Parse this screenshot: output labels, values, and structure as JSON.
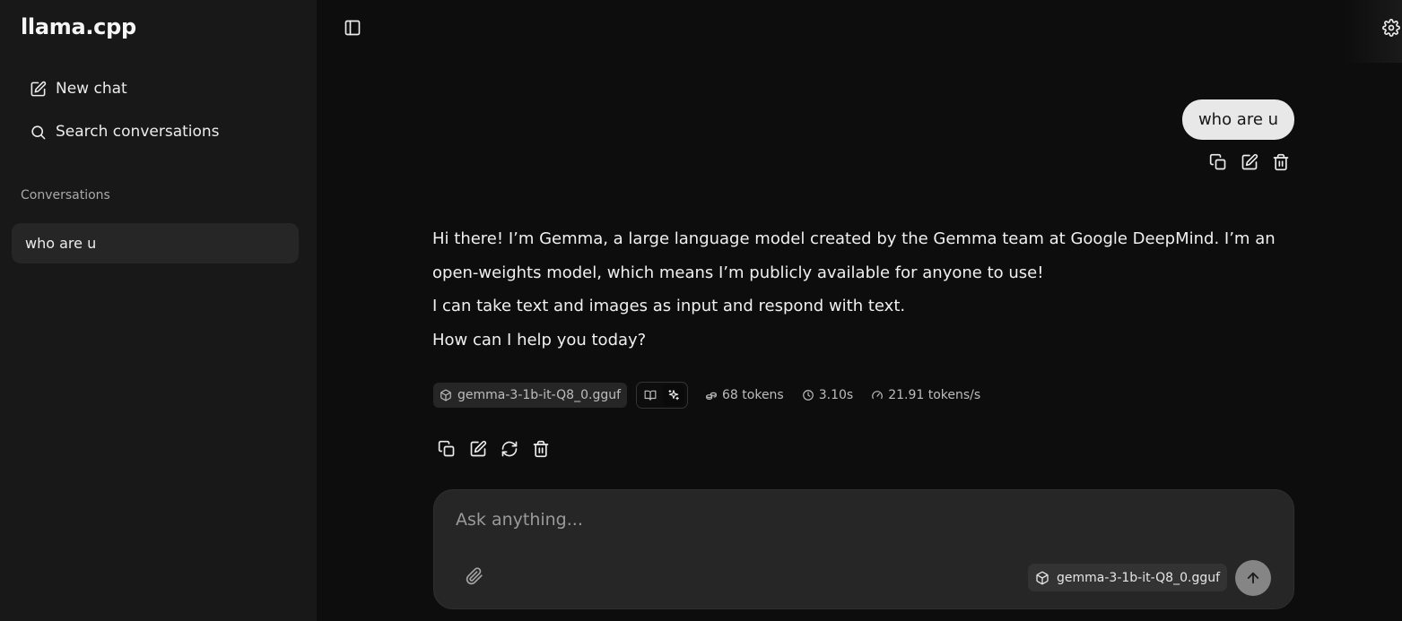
{
  "app": {
    "title": "llama.cpp"
  },
  "sidebar": {
    "new_chat_label": "New chat",
    "search_label": "Search conversations",
    "section_label": "Conversations",
    "conversations": [
      {
        "title": "who are u",
        "active": true
      }
    ]
  },
  "chat": {
    "user_message": "who are u",
    "assistant_message": [
      "Hi there! I’m Gemma, a large language model created by the Gemma team at Google DeepMind. I’m an open-weights model, which means I’m publicly available for anyone to use!",
      "I can take text and images as input and respond with text.",
      "How can I help you today?"
    ],
    "meta": {
      "model": "gemma-3-1b-it-Q8_0.gguf",
      "tokens": "68 tokens",
      "time": "3.10s",
      "speed": "21.91 tokens/s"
    }
  },
  "composer": {
    "placeholder": "Ask anything...",
    "model": "gemma-3-1b-it-Q8_0.gguf"
  },
  "icons": {
    "sidebar_toggle": "panel-left-icon",
    "settings": "gear-icon",
    "new_chat": "square-pen-icon",
    "search": "search-icon",
    "copy": "copy-icon",
    "edit": "pencil-icon",
    "delete": "trash-icon",
    "regenerate": "refresh-icon",
    "model": "cube-icon",
    "read_mode": "book-icon",
    "sparkle_mode": "sparkles-icon",
    "tokens": "token-stack-icon",
    "time": "clock-icon",
    "speed": "gauge-icon",
    "attach": "paperclip-icon",
    "send": "arrow-up-icon"
  },
  "colors": {
    "background": "#0d0d0d",
    "sidebar": "#181818",
    "user_bubble": "#e8e8e8",
    "composer": "#262626",
    "send_button": "#858585"
  }
}
